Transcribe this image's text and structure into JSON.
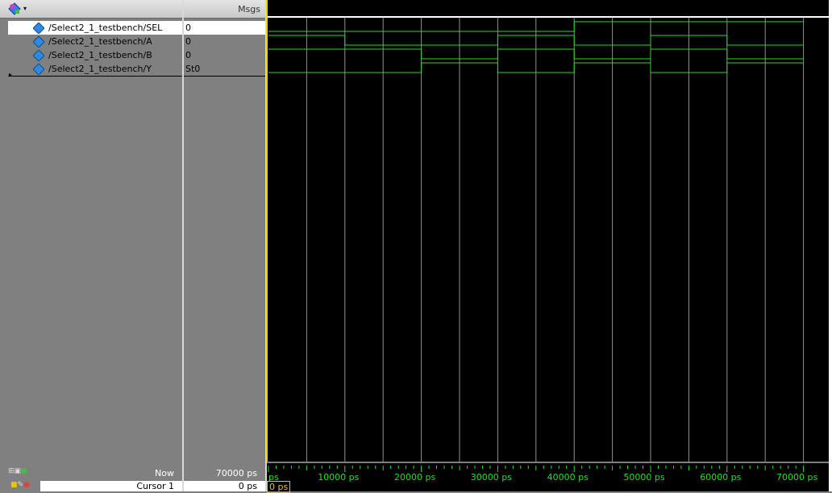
{
  "toolbar": {
    "icon": "wave-add-icon",
    "dropdown": "chevron-down-icon"
  },
  "headers": {
    "msgs": "Msgs"
  },
  "signals": [
    {
      "name": "/Select2_1_testbench/SEL",
      "value": "0",
      "selected": true
    },
    {
      "name": "/Select2_1_testbench/A",
      "value": "0"
    },
    {
      "name": "/Select2_1_testbench/B",
      "value": "0"
    },
    {
      "name": "/Select2_1_testbench/Y",
      "value": "St0"
    }
  ],
  "footer": {
    "now_label": "Now",
    "now_value": "70000 ps",
    "cursor_label": "Cursor 1",
    "cursor_value": "0 ps",
    "cursor_box": "0 ps"
  },
  "timeline": {
    "unit": "ps",
    "labels": [
      "ps",
      "10000 ps",
      "20000 ps",
      "30000 ps",
      "40000 ps",
      "50000 ps",
      "60000 ps",
      "70000 ps"
    ]
  },
  "colors": {
    "wave": "#20e020",
    "grid": "#909090",
    "cursor": "#e8d020",
    "background": "#000000"
  },
  "waveforms": {
    "SEL": [
      [
        0,
        0
      ],
      [
        40000,
        1
      ],
      [
        70000,
        1
      ]
    ],
    "A": [
      [
        0,
        1
      ],
      [
        10000,
        0
      ],
      [
        30000,
        1
      ],
      [
        40000,
        0
      ],
      [
        50000,
        1
      ],
      [
        60000,
        0
      ],
      [
        70000,
        0
      ]
    ],
    "B": [
      [
        0,
        1
      ],
      [
        20000,
        0
      ],
      [
        30000,
        1
      ],
      [
        40000,
        0
      ],
      [
        50000,
        1
      ],
      [
        60000,
        0
      ],
      [
        70000,
        0
      ]
    ],
    "Y": [
      [
        0,
        0
      ],
      [
        20000,
        1
      ],
      [
        30000,
        0
      ],
      [
        40000,
        1
      ],
      [
        50000,
        0
      ],
      [
        60000,
        1
      ],
      [
        70000,
        1
      ]
    ]
  }
}
